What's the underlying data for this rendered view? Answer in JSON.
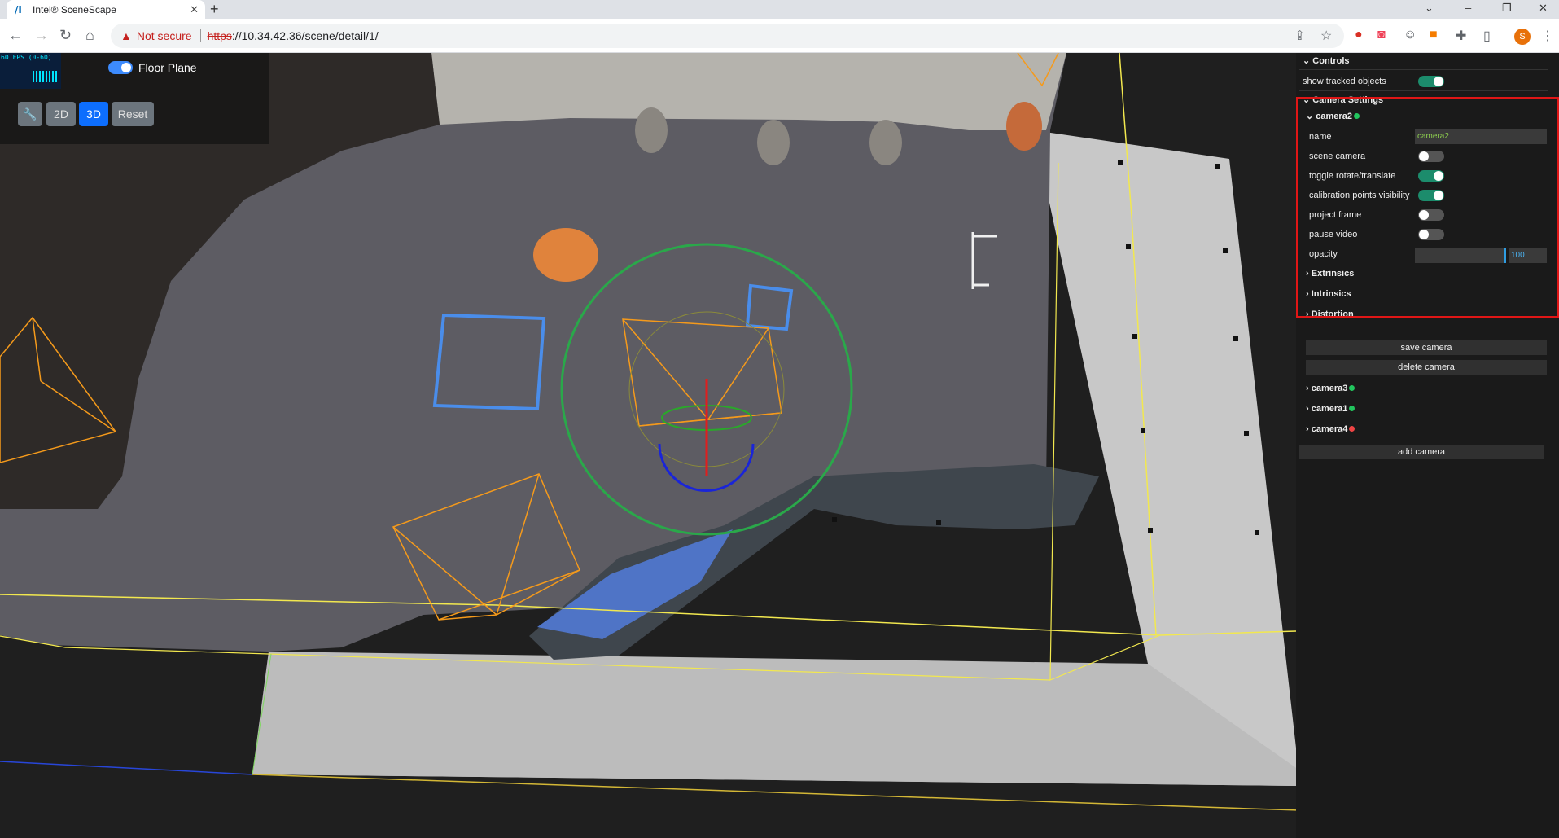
{
  "browser": {
    "tab_title": "Intel® SceneScape",
    "url_protocol": "https",
    "url_rest": "://10.34.42.36/scene/detail/1/",
    "security_label": "Not secure",
    "profile_initial": "S"
  },
  "viewport": {
    "fps_label": "60 FPS (0-60)",
    "floor_plane_label": "Floor Plane",
    "floor_plane_on": true,
    "buttons": {
      "btn_2d": "2D",
      "btn_3d": "3D",
      "btn_reset": "Reset"
    },
    "active_view": "3D"
  },
  "panel": {
    "controls_title": "Controls",
    "show_tracked_label": "show tracked objects",
    "show_tracked_on": true,
    "camera_settings_title": "Camera Settings",
    "active_camera": {
      "title": "camera2",
      "status_color": "#22c55e",
      "name_label": "name",
      "name_value": "camera2",
      "scene_camera_label": "scene camera",
      "scene_camera_on": false,
      "toggle_rotate_label": "toggle rotate/translate",
      "toggle_rotate_on": true,
      "calib_points_label": "calibration points visibility",
      "calib_points_on": true,
      "project_frame_label": "project frame",
      "project_frame_on": false,
      "pause_video_label": "pause video",
      "pause_video_on": false,
      "opacity_label": "opacity",
      "opacity_value": "100",
      "extrinsics_label": "Extrinsics",
      "intrinsics_label": "Intrinsics",
      "distortion_label": "Distortion",
      "save_label": "save camera",
      "delete_label": "delete camera"
    },
    "other_cameras": [
      {
        "name": "camera3",
        "status_color": "#22c55e"
      },
      {
        "name": "camera1",
        "status_color": "#22c55e"
      },
      {
        "name": "camera4",
        "status_color": "#ef4444"
      }
    ],
    "add_camera_label": "add camera"
  },
  "colors": {
    "accent_blue": "#0d6efd",
    "toggle_on": "#1c8c6c",
    "highlight_red": "#e01616"
  }
}
